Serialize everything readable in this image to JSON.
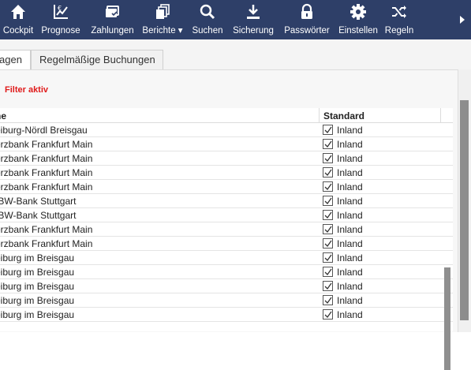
{
  "toolbar": {
    "items": [
      {
        "label": "Cockpit",
        "icon": "home-icon"
      },
      {
        "label": "Prognose",
        "icon": "forecast-icon"
      },
      {
        "label": "Zahlungen",
        "icon": "payments-icon"
      },
      {
        "label": "Berichte ▾",
        "icon": "reports-icon"
      },
      {
        "label": "Suchen",
        "icon": "search-icon"
      },
      {
        "label": "Sicherung",
        "icon": "download-icon"
      },
      {
        "label": "Passwörter",
        "icon": "lock-icon"
      },
      {
        "label": "Einstellen",
        "icon": "gear-icon"
      },
      {
        "label": "Regeln",
        "icon": "shuffle-icon"
      }
    ],
    "more_icon": "chevron-right-icon"
  },
  "tabs": [
    {
      "label": "agen"
    },
    {
      "label": "Regelmäßige Buchungen"
    }
  ],
  "filter_label": "Filter aktiv",
  "grid": {
    "columns": [
      "ne",
      "Standard"
    ],
    "rows": [
      {
        "name": "eiburg-Nördl Breisgau",
        "standard": "Inland",
        "checked": true
      },
      {
        "name": "erzbank Frankfurt Main",
        "standard": "Inland",
        "checked": true
      },
      {
        "name": "erzbank Frankfurt Main",
        "standard": "Inland",
        "checked": true
      },
      {
        "name": "erzbank Frankfurt Main",
        "standard": "Inland",
        "checked": true
      },
      {
        "name": "erzbank Frankfurt Main",
        "standard": "Inland",
        "checked": true
      },
      {
        "name": "/BW-Bank Stuttgart",
        "standard": "Inland",
        "checked": true
      },
      {
        "name": "/BW-Bank Stuttgart",
        "standard": "Inland",
        "checked": true
      },
      {
        "name": "erzbank Frankfurt Main",
        "standard": "Inland",
        "checked": true
      },
      {
        "name": "erzbank Frankfurt Main",
        "standard": "Inland",
        "checked": true
      },
      {
        "name": "eiburg im Breisgau",
        "standard": "Inland",
        "checked": true
      },
      {
        "name": "eiburg im Breisgau",
        "standard": "Inland",
        "checked": true
      },
      {
        "name": "eiburg im Breisgau",
        "standard": "Inland",
        "checked": true
      },
      {
        "name": "eiburg im Breisgau",
        "standard": "Inland",
        "checked": true
      },
      {
        "name": "eiburg im Breisgau",
        "standard": "Inland",
        "checked": true
      }
    ]
  },
  "colors": {
    "toolbar_bg": "#2e3f68",
    "filter_text": "#e01b1b"
  }
}
